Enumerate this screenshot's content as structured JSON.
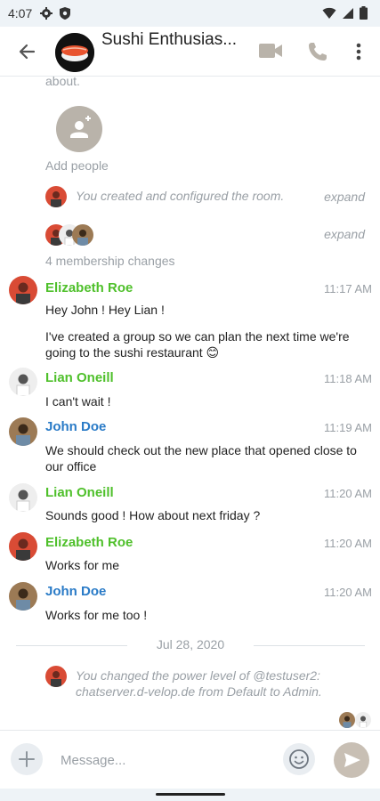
{
  "status_bar": {
    "time": "4:07"
  },
  "header": {
    "title": "Sushi Enthusias..."
  },
  "timeline": {
    "cut_text": "about.",
    "add_people": "Add people",
    "created_notice": "You created and configured the room.",
    "expand": "expand",
    "membership_changes": "4 membership changes",
    "messages": [
      {
        "sender": "Elizabeth Roe",
        "time": "11:17 AM",
        "lines": [
          "Hey John ! Hey Lian !",
          "I've created a group so we can plan the next time we're going to the sushi restaurant 😊"
        ]
      },
      {
        "sender": "Lian Oneill",
        "time": "11:18 AM",
        "lines": [
          "I can't wait !"
        ]
      },
      {
        "sender": "John Doe",
        "time": "11:19 AM",
        "lines": [
          "We should check out the new place that opened close to our office"
        ]
      },
      {
        "sender": "Lian Oneill",
        "time": "11:20 AM",
        "lines": [
          "Sounds good ! How about next friday ?"
        ]
      },
      {
        "sender": "Elizabeth Roe",
        "time": "11:20 AM",
        "lines": [
          "Works for me"
        ]
      },
      {
        "sender": "John Doe",
        "time": "11:20 AM",
        "lines": [
          "Works for me too !"
        ]
      }
    ],
    "date_separator": "Jul 28, 2020",
    "power_notice": "You changed the power level of @testuser2: chatserver.d-velop.de from Default to Admin."
  },
  "composer": {
    "placeholder": "Message..."
  },
  "colors": {
    "sender_green": "#4fc02b",
    "sender_blue": "#2a7bc7",
    "accent_beige": "#b9b3aa"
  }
}
